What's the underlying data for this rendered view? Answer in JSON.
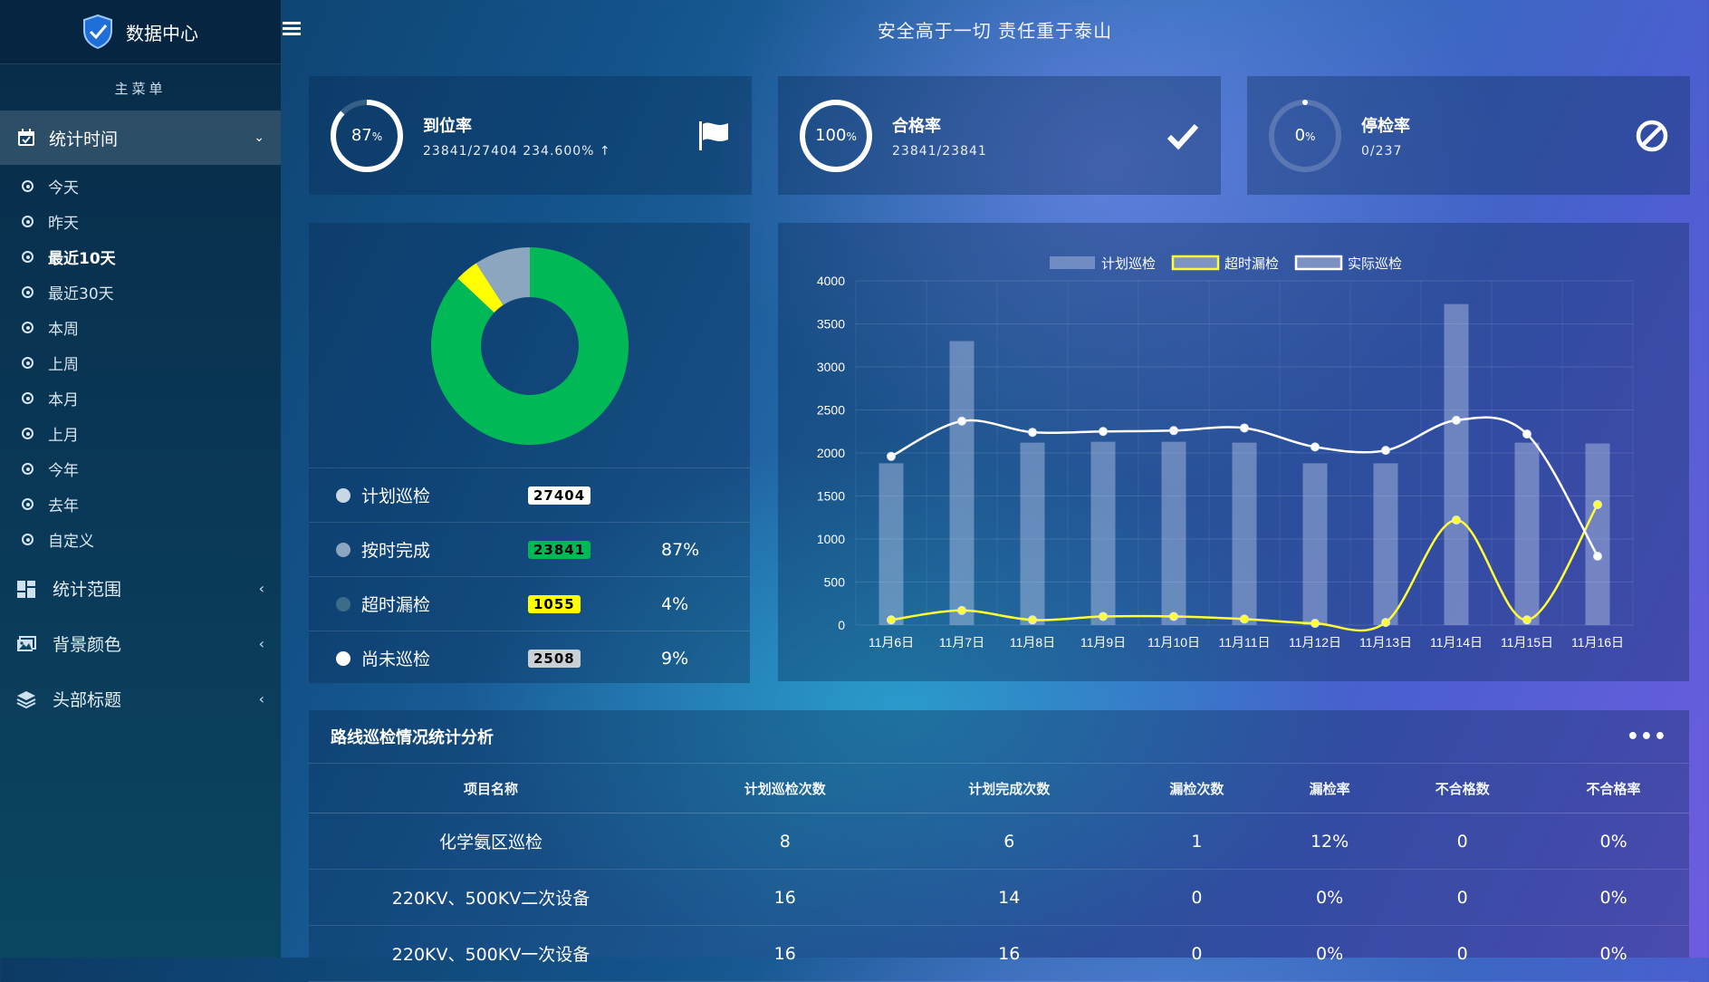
{
  "brand": {
    "title": "数据中心"
  },
  "sidebar": {
    "menu_title": "主菜单",
    "time_menu": {
      "label": "统计时间",
      "items": [
        {
          "label": "今天"
        },
        {
          "label": "昨天"
        },
        {
          "label": "最近10天",
          "active": true
        },
        {
          "label": "最近30天"
        },
        {
          "label": "本周"
        },
        {
          "label": "上周"
        },
        {
          "label": "本月"
        },
        {
          "label": "上月"
        },
        {
          "label": "今年"
        },
        {
          "label": "去年"
        },
        {
          "label": "自定义"
        }
      ]
    },
    "groups": [
      {
        "label": "统计范围",
        "icon": "dashboard-icon"
      },
      {
        "label": "背景颜色",
        "icon": "images-icon"
      },
      {
        "label": "头部标题",
        "icon": "layers-icon"
      }
    ]
  },
  "header": {
    "title": "安全高于一切 责任重于泰山"
  },
  "stats": [
    {
      "title": "到位率",
      "value": "87",
      "unit": "%",
      "sub": "23841/27404 234.600%",
      "percent": 87,
      "icon": "flag-icon",
      "trend_icon": "arrow-up-icon"
    },
    {
      "title": "合格率",
      "value": "100",
      "unit": "%",
      "sub": "23841/23841",
      "percent": 100,
      "icon": "check-icon"
    },
    {
      "title": "停检率",
      "value": "0",
      "unit": "%",
      "sub": "0/237",
      "percent": 0,
      "icon": "ban-icon"
    }
  ],
  "donut": {
    "segments": [
      {
        "name": "按时完成",
        "value": 23841,
        "color": "#00b956"
      },
      {
        "name": "超时漏检",
        "value": 1055,
        "color": "#ffff00"
      },
      {
        "name": "尚未巡检",
        "value": 2508,
        "color": "#8ca6bf"
      }
    ],
    "legend": [
      {
        "name": "计划巡检",
        "count": "27404",
        "pct": "",
        "dot": "#c9d6e3",
        "badge_bg": "#ffffff",
        "badge_fg": "#000000"
      },
      {
        "name": "按时完成",
        "count": "23841",
        "pct": "87%",
        "dot": "#8ca6bf",
        "badge_bg": "#00b956",
        "badge_fg": "#000000"
      },
      {
        "name": "超时漏检",
        "count": "1055",
        "pct": "4%",
        "dot": "#3d6b8a",
        "badge_bg": "#ffff00",
        "badge_fg": "#000000"
      },
      {
        "name": "尚未巡检",
        "count": "2508",
        "pct": "9%",
        "dot": "#ffffff",
        "badge_bg": "#c9d0d6",
        "badge_fg": "#000000"
      }
    ]
  },
  "chart_data": {
    "type": "bar",
    "legend_position": "top",
    "categories": [
      "11月6日",
      "11月7日",
      "11月8日",
      "11月9日",
      "11月10日",
      "11月11日",
      "11月12日",
      "11月13日",
      "11月14日",
      "11月15日",
      "11月16日"
    ],
    "ylim": [
      0,
      4000
    ],
    "yticks": [
      0,
      500,
      1000,
      1500,
      2000,
      2500,
      3000,
      3500,
      4000
    ],
    "grid": true,
    "series": [
      {
        "name": "计划巡检",
        "type": "bar",
        "color": "#b8c8e8",
        "values": [
          1880,
          3300,
          2120,
          2130,
          2130,
          2120,
          1880,
          1880,
          3730,
          2120,
          2110
        ]
      },
      {
        "name": "超时漏检",
        "type": "line",
        "color": "#ffff33",
        "values": [
          60,
          170,
          60,
          100,
          100,
          70,
          20,
          30,
          1220,
          60,
          1400
        ]
      },
      {
        "name": "实际巡检",
        "type": "line",
        "color": "#ffffff",
        "values": [
          1960,
          2370,
          2240,
          2250,
          2260,
          2290,
          2070,
          2030,
          2380,
          2220,
          800
        ]
      }
    ]
  },
  "table": {
    "title": "路线巡检情况统计分析",
    "columns": [
      "项目名称",
      "计划巡检次数",
      "计划完成次数",
      "漏检次数",
      "漏检率",
      "不合格数",
      "不合格率"
    ],
    "rows": [
      [
        "化学氨区巡检",
        "8",
        "6",
        "1",
        "12%",
        "0",
        "0%"
      ],
      [
        "220KV、500KV二次设备",
        "16",
        "14",
        "0",
        "0%",
        "0",
        "0%"
      ],
      [
        "220KV、500KV一次设备",
        "16",
        "16",
        "0",
        "0%",
        "0",
        "0%"
      ]
    ]
  },
  "colors": {
    "accent": "#00b956",
    "warning": "#ffff00",
    "sidebar": "#072b47"
  }
}
